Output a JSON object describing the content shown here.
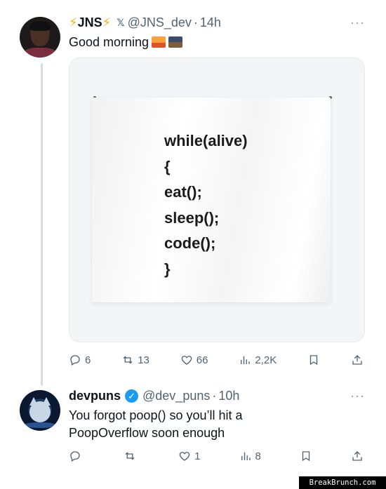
{
  "tweet1": {
    "name": "JNS",
    "handle": "@JNS_dev",
    "time": "14h",
    "text": "Good morning",
    "emojis": [
      "sunrise-emoji",
      "sunrise-over-mountains-emoji"
    ],
    "image_code_lines": [
      "while(alive)",
      "{",
      "eat();",
      "sleep();",
      "code();",
      "}"
    ],
    "actions": {
      "replies": "6",
      "reposts": "13",
      "likes": "66",
      "views": "2,2K"
    }
  },
  "tweet2": {
    "name": "devpuns",
    "handle": "@dev_puns",
    "time": "10h",
    "text_line1": "You forgot poop() so you’ll hit a",
    "text_line2": "PoopOverflow soon enough",
    "actions": {
      "replies": "",
      "reposts": "",
      "likes": "1",
      "views": "8"
    }
  },
  "dot": "·",
  "more": "···",
  "watermark": "BreakBrunch.com",
  "colors": {
    "verified": "#1d9bf0",
    "secondary_text": "#536471",
    "bolt": "#f2b705"
  }
}
